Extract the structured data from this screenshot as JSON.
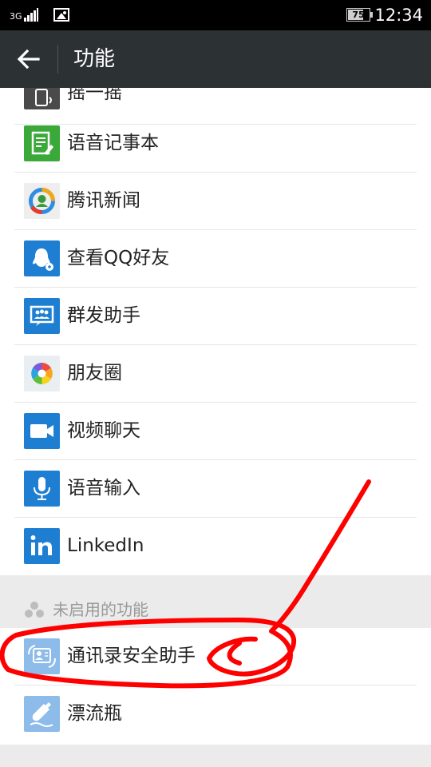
{
  "status_bar": {
    "network": "3G",
    "battery_level": 75,
    "battery_text": "75",
    "time": "12:34"
  },
  "header": {
    "title": "功能",
    "back_icon": "arrow-left-icon"
  },
  "items": [
    {
      "label": "摇一摇",
      "icon": "phone-shake-icon",
      "color": "#4a4a4a"
    },
    {
      "label": "语音记事本",
      "icon": "voice-notepad-icon",
      "color": "#3aa93a"
    },
    {
      "label": "腾讯新闻",
      "icon": "tencent-news-icon",
      "color": "#f0f0f0"
    },
    {
      "label": "查看QQ好友",
      "icon": "qq-friends-icon",
      "color": "#1e7fd2"
    },
    {
      "label": "群发助手",
      "icon": "group-message-icon",
      "color": "#1e7fd2"
    },
    {
      "label": "朋友圈",
      "icon": "moments-icon",
      "color": "#e8eef2"
    },
    {
      "label": "视频聊天",
      "icon": "video-chat-icon",
      "color": "#1e7fd2"
    },
    {
      "label": "语音输入",
      "icon": "voice-input-icon",
      "color": "#1e7fd2"
    },
    {
      "label": "LinkedIn",
      "icon": "linkedin-icon",
      "color": "#1e7fd2"
    }
  ],
  "disabled_section": {
    "title": "未启用的功能",
    "icon": "people-icon",
    "items": [
      {
        "label": "通讯录安全助手",
        "icon": "contacts-security-icon",
        "color": "#8ebcea"
      },
      {
        "label": "漂流瓶",
        "icon": "drift-bottle-icon",
        "color": "#8ebcea"
      }
    ]
  },
  "annotation": {
    "color": "#ff0000"
  }
}
